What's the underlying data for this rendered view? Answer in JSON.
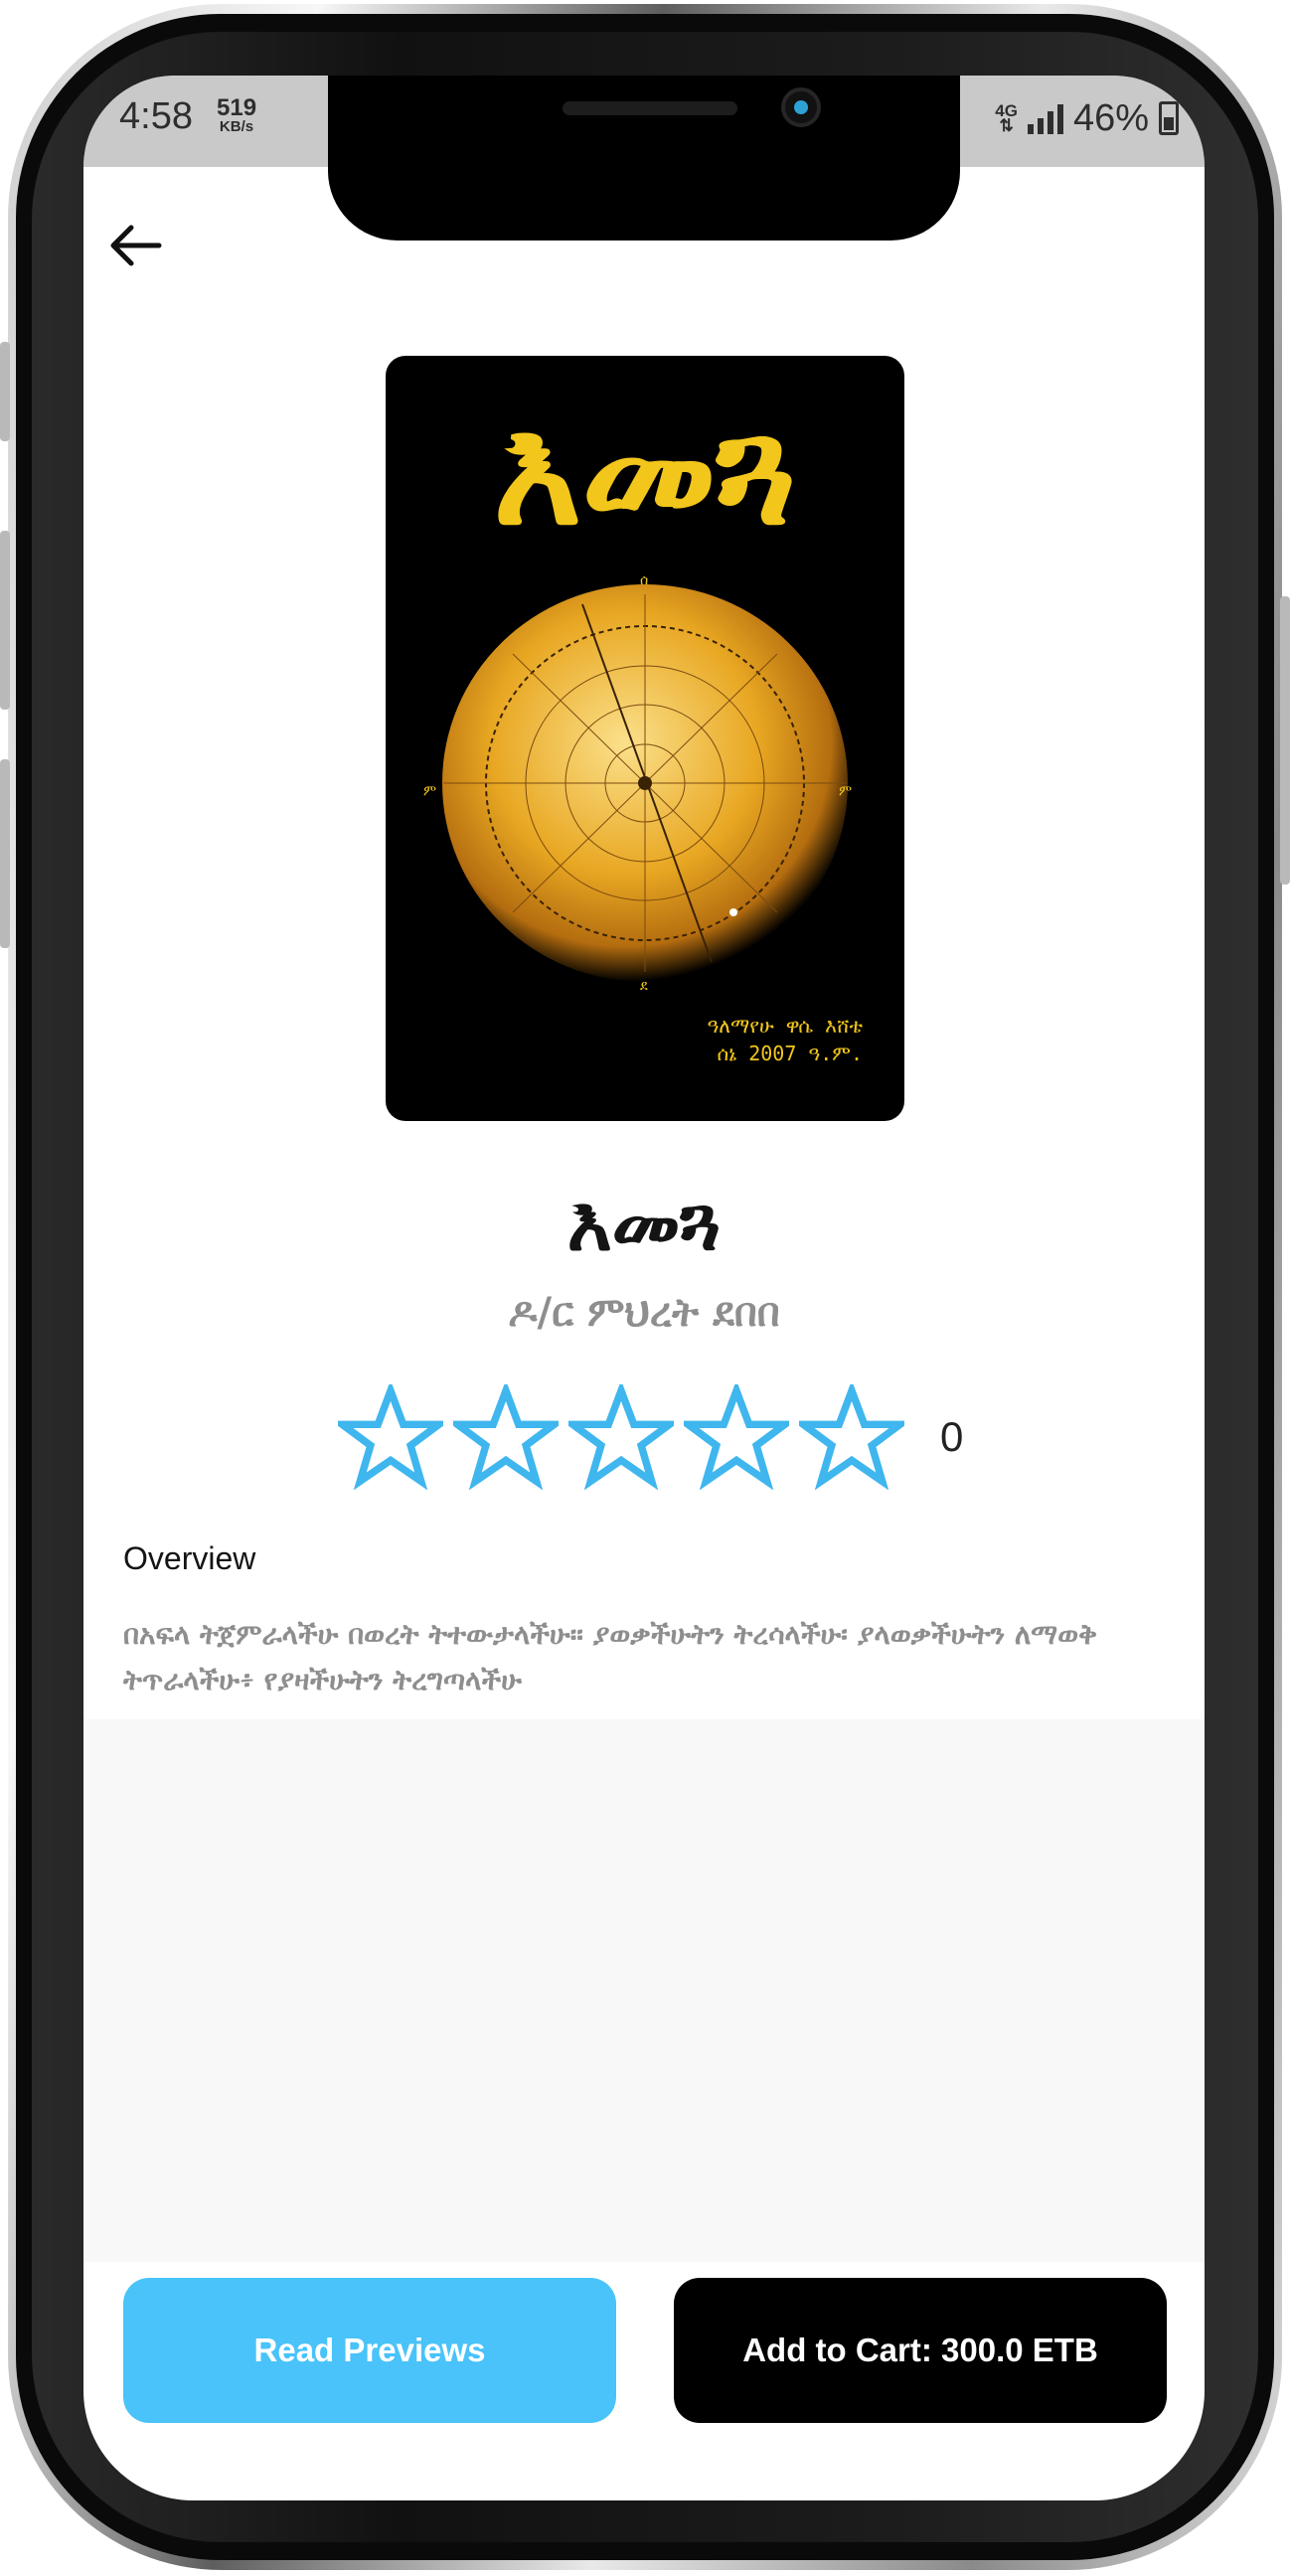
{
  "statusbar": {
    "time": "4:58",
    "speed_value": "519",
    "speed_unit": "KB/s",
    "network": "4G",
    "battery": "46%"
  },
  "icons": {
    "back": "arrow-left-icon",
    "star": "star-outline-icon",
    "battery": "battery-icon",
    "signal": "signal-icon"
  },
  "book": {
    "cover": {
      "title": "እመጓ",
      "footer_line1": "ዓለማየሁ ዋሴ እሸቴ",
      "footer_line2": "ሰኔ 2007 ዓ.ም."
    },
    "title": "እመጓ",
    "author": "ዶ/ር ምህረት ደበበ",
    "rating": {
      "stars_filled": 0,
      "stars_total": 5,
      "count": "0"
    }
  },
  "overview": {
    "label": "Overview",
    "text": "በአፍላ ትጀምራላችሁ በወረት ትተውታላችሁ። ያወቃችሁትን ትረሳላችሁ፡ ያላወቃችሁትን ለማወቅ ትጥራላችሁ፥ የያዛችሁትን ትረግጣላችሁ"
  },
  "actions": {
    "read_previews": "Read Previews",
    "add_to_cart": "Add to Cart: 300.0 ETB"
  },
  "colors": {
    "accent": "#49c3f9",
    "star_outline": "#3fb6ee",
    "cart_button": "#000000",
    "cover_title": "#f2c61a"
  }
}
